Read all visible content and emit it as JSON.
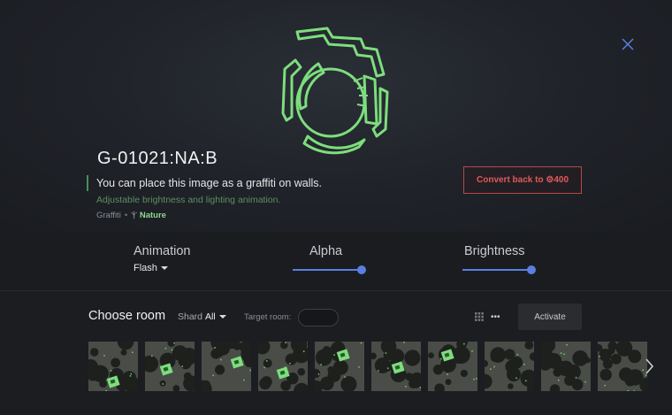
{
  "item": {
    "code": "G-01021:NA:B",
    "description": "You can place this image as a graffiti on walls.",
    "sub_description": "Adjustable brightness and lighting animation.",
    "tag_type": "Graffiti",
    "tag_bullet": "•",
    "tag_prefix": "Ⲯ",
    "tag_category": "Nature",
    "convert_label": "Convert back to ⚙400"
  },
  "controls": {
    "animation_label": "Animation",
    "animation_value": "Flash",
    "alpha_label": "Alpha",
    "alpha_value": 1.0,
    "brightness_label": "Brightness",
    "brightness_value": 1.0
  },
  "rooms_panel": {
    "title": "Choose room",
    "shard_label": "Shard",
    "shard_value": "All",
    "target_room_label": "Target room:",
    "target_room_value": "",
    "more_label": "•••",
    "activate_label": "Activate",
    "room_count": 10
  },
  "colors": {
    "accent_green": "#7dde7d",
    "danger_red": "#e05a5a",
    "slider_blue": "#5a7fe0"
  },
  "icons": {
    "close": "close-icon",
    "grid": "grid-icon",
    "more": "more-icon",
    "next": "chevron-right-icon"
  }
}
